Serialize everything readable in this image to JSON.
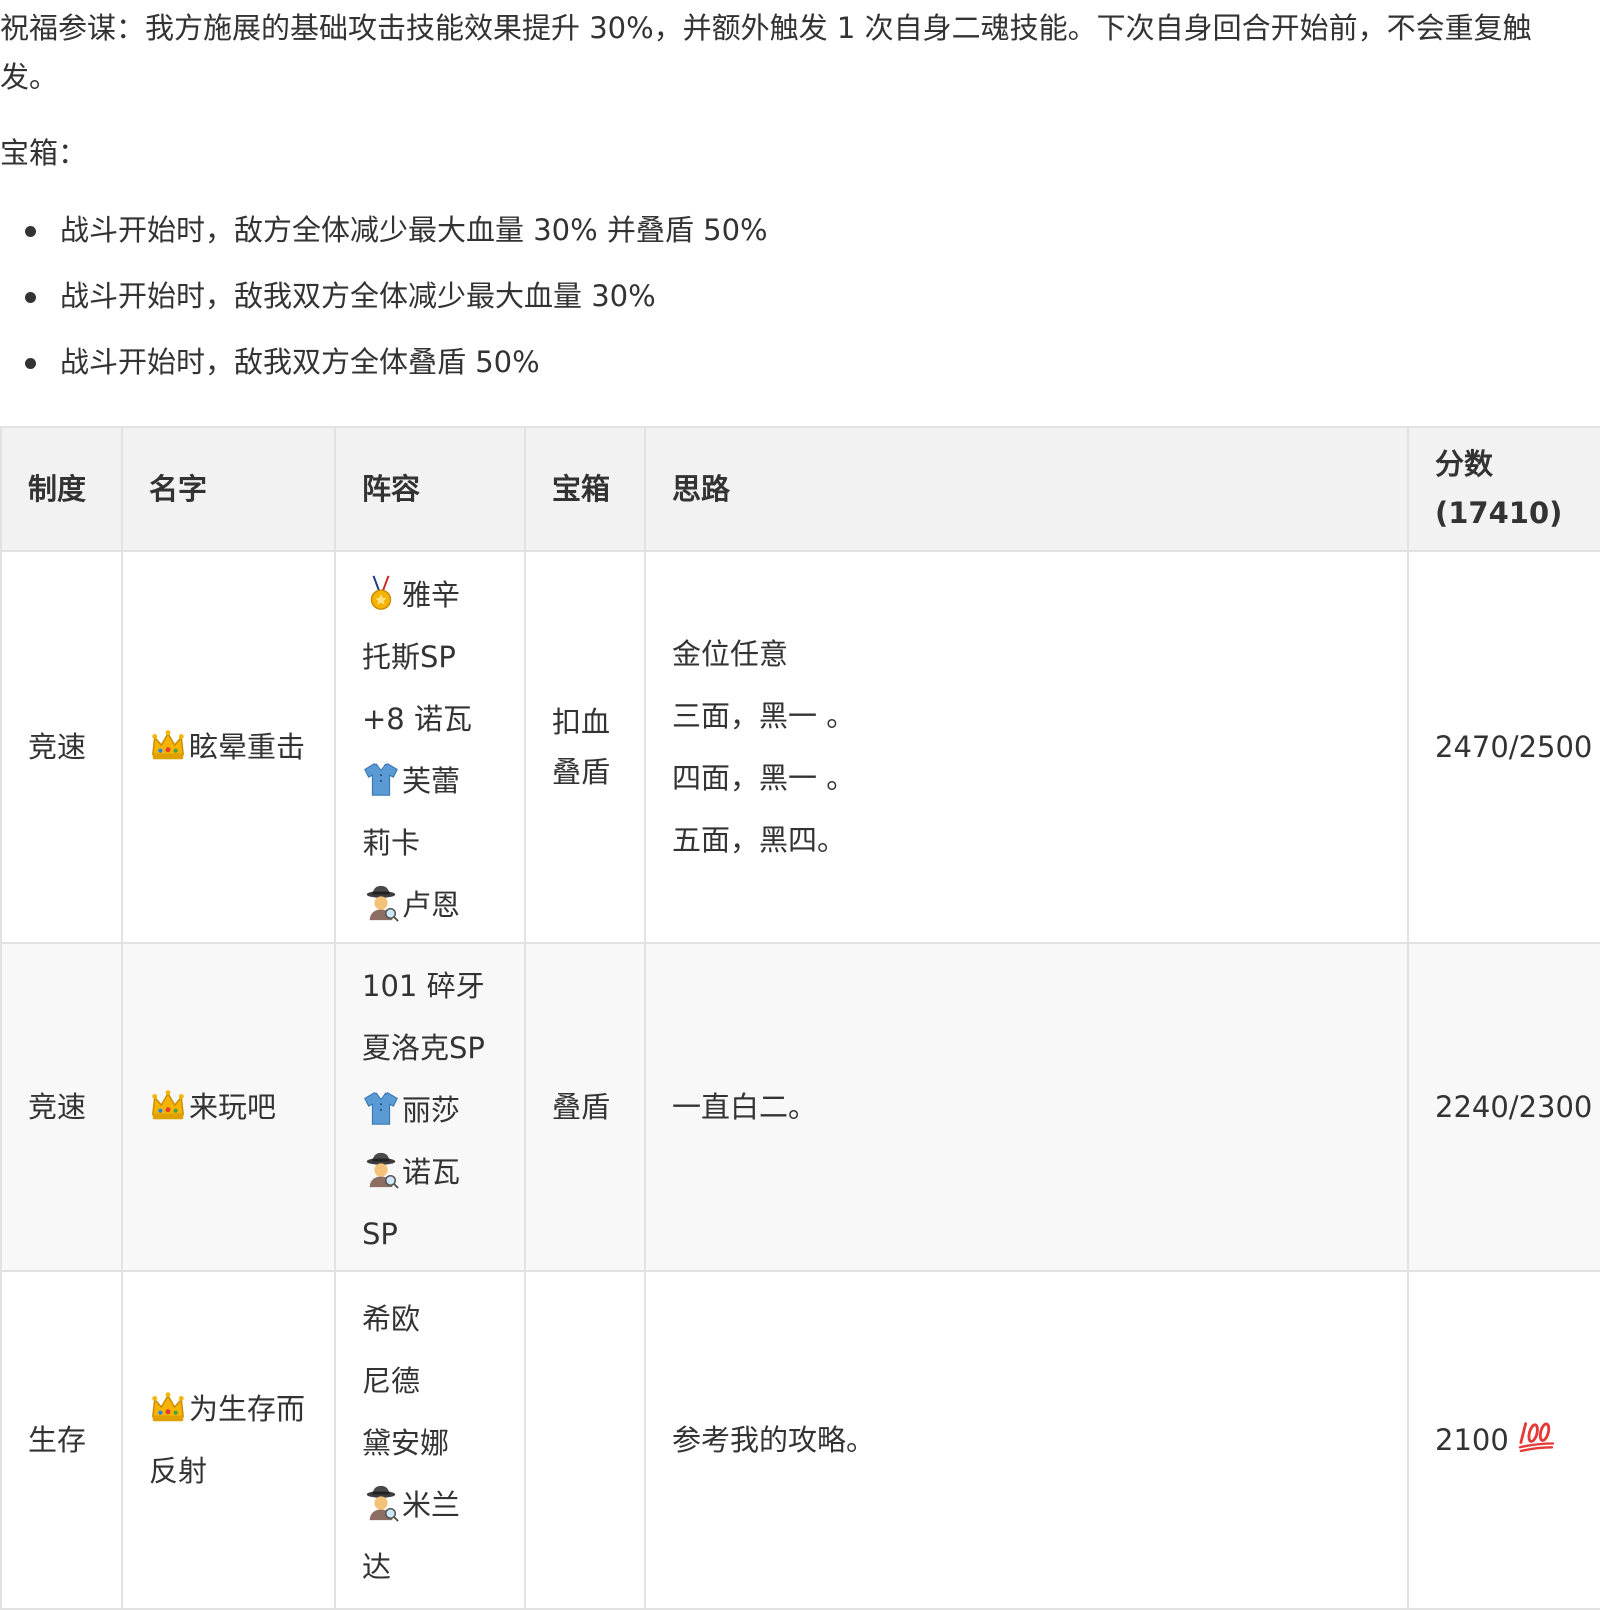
{
  "intro": {
    "blessing": "祝福参谋：我方施展的基础攻击技能效果提升 30%，并额外触发 1 次自身二魂技能。下次自身回合开始前，不会重复触发。"
  },
  "chest": {
    "heading": "宝箱：",
    "items": [
      "战斗开始时，敌方全体减少最大血量 30% 并叠盾 50%",
      "战斗开始时，敌我双方全体减少最大血量 30%",
      "战斗开始时，敌我双方全体叠盾 50%"
    ]
  },
  "table": {
    "headers": {
      "system": "制度",
      "name": "名字",
      "lineup": "阵容",
      "chest": "宝箱",
      "plan": "思路",
      "score_label": "分数",
      "score_total": "(17410)"
    },
    "rows": [
      {
        "system": "竞速",
        "name_icon": "crown-icon",
        "name": "眩晕重击",
        "lineup": [
          {
            "icon": "medal-icon",
            "text": "雅辛"
          },
          {
            "icon": "",
            "text": "托斯SP"
          },
          {
            "icon": "",
            "text": "+8 诺瓦"
          },
          {
            "icon": "shirt-icon",
            "text": "芙蕾"
          },
          {
            "icon": "",
            "text": "莉卡"
          },
          {
            "icon": "detective-icon",
            "text": "卢恩"
          }
        ],
        "chest": "扣血叠盾",
        "plan": [
          "金位任意",
          "三面，黑一 。",
          "四面，黑一 。",
          "五面，黑四。"
        ],
        "score": "2470/2500",
        "score_icon": ""
      },
      {
        "system": "竞速",
        "name_icon": "crown-icon",
        "name": "来玩吧",
        "lineup": [
          {
            "icon": "",
            "text": "101 碎牙"
          },
          {
            "icon": "",
            "text": "夏洛克SP"
          },
          {
            "icon": "shirt-icon",
            "text": "丽莎"
          },
          {
            "icon": "detective-icon",
            "text": "诺瓦"
          },
          {
            "icon": "",
            "text": "SP"
          }
        ],
        "chest": "叠盾",
        "plan": [
          "一直白二。"
        ],
        "score": "2240/2300",
        "score_icon": ""
      },
      {
        "system": "生存",
        "name_icon": "crown-icon",
        "name": "为生存而反射",
        "lineup": [
          {
            "icon": "",
            "text": "希欧"
          },
          {
            "icon": "",
            "text": "尼德"
          },
          {
            "icon": "",
            "text": "黛安娜"
          },
          {
            "icon": "detective-icon",
            "text": "米兰"
          },
          {
            "icon": "",
            "text": "达"
          }
        ],
        "chest": "",
        "plan": [
          "参考我的攻略。"
        ],
        "score": "2100",
        "score_icon": "hundred-points-icon"
      }
    ]
  }
}
